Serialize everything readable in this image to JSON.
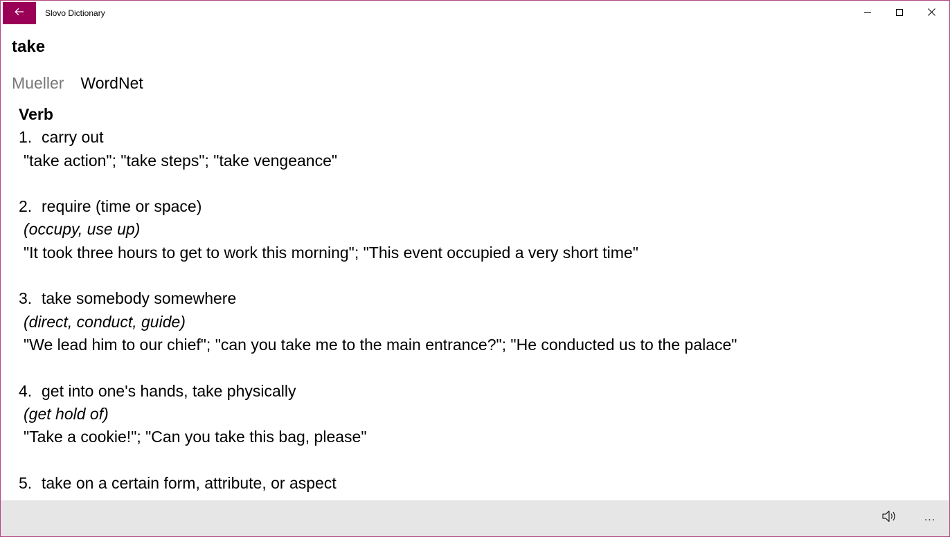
{
  "window": {
    "title": "Slovo Dictionary",
    "accent_color": "#9b0057",
    "border_color": "#b3447f"
  },
  "icons": {
    "back": "back-arrow-icon",
    "minimize": "minimize-icon",
    "maximize": "maximize-icon",
    "close": "close-icon",
    "speaker": "speaker-icon",
    "more": "more-icon"
  },
  "entry": {
    "word": "take"
  },
  "tabs": [
    {
      "label": "Mueller",
      "active": false
    },
    {
      "label": "WordNet",
      "active": true
    }
  ],
  "definitions": {
    "part_of_speech": "Verb",
    "senses": [
      {
        "number": "1.",
        "gloss": "carry out",
        "synonyms": "",
        "examples": "\"take action\"; \"take steps\"; \"take vengeance\""
      },
      {
        "number": "2.",
        "gloss": "require (time or space)",
        "synonyms": "(occupy, use up)",
        "examples": "\"It took three hours to get to work this morning\"; \"This event occupied a very short time\""
      },
      {
        "number": "3.",
        "gloss": "take somebody somewhere",
        "synonyms": "(direct, conduct, guide)",
        "examples": "\"We lead him to our chief\"; \"can you take me to the main entrance?\"; \"He conducted us to the palace\""
      },
      {
        "number": "4.",
        "gloss": "get into one's hands, take physically",
        "synonyms": "(get hold of)",
        "examples": "\"Take a cookie!\"; \"Can you take this bag, please\""
      },
      {
        "number": "5.",
        "gloss": "take on a certain form, attribute, or aspect",
        "synonyms": "",
        "examples": ""
      }
    ]
  },
  "appbar": {
    "more_label": "..."
  }
}
